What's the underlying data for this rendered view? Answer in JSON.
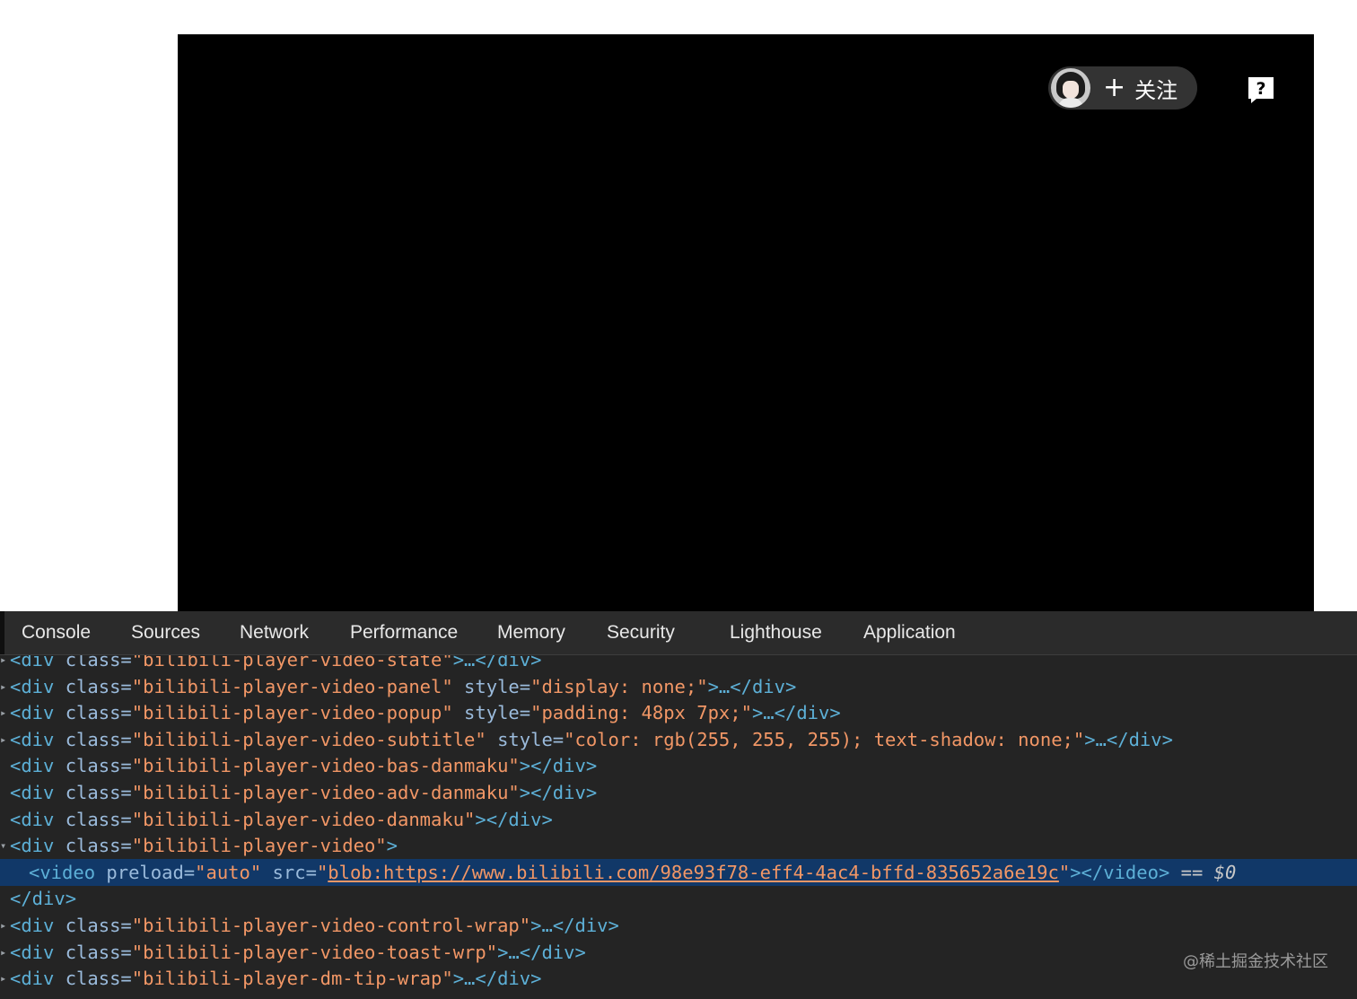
{
  "player": {
    "follow_label": "关注",
    "plus_symbol": "+",
    "help_symbol": "?"
  },
  "devtools": {
    "tabs": [
      "Console",
      "Sources",
      "Network",
      "Performance",
      "Memory",
      "Security",
      "Lighthouse",
      "Application"
    ],
    "lines": [
      {
        "prefix": "<div ",
        "attr": "class=",
        "value": "\"bilibili-player-video-state\"",
        "suffix": ">…</div>",
        "collapsed": true
      },
      {
        "prefix": "<div ",
        "attr": "class=",
        "value": "\"bilibili-player-video-panel\"",
        "attr2": " style=",
        "value2": "\"display: none;\"",
        "suffix": ">…</div>",
        "collapsed": true
      },
      {
        "prefix": "<div ",
        "attr": "class=",
        "value": "\"bilibili-player-video-popup\"",
        "attr2": " style=",
        "value2": "\"padding: 48px 7px;\"",
        "suffix": ">…</div>",
        "collapsed": true
      },
      {
        "prefix": "<div ",
        "attr": "class=",
        "value": "\"bilibili-player-video-subtitle\"",
        "attr2": " style=",
        "value2": "\"color: rgb(255, 255, 255); text-shadow: none;\"",
        "suffix": ">…</div>",
        "collapsed": true
      },
      {
        "prefix": "<div ",
        "attr": "class=",
        "value": "\"bilibili-player-video-bas-danmaku\"",
        "suffix": "></div>"
      },
      {
        "prefix": "<div ",
        "attr": "class=",
        "value": "\"bilibili-player-video-adv-danmaku\"",
        "suffix": "></div>"
      },
      {
        "prefix": "<div ",
        "attr": "class=",
        "value": "\"bilibili-player-video-danmaku\"",
        "suffix": "></div>"
      },
      {
        "prefix": "<div ",
        "attr": "class=",
        "value": "\"bilibili-player-video\"",
        "suffix": ">",
        "expanded": true
      },
      {
        "selected": true,
        "prefix": "<video ",
        "attr": "preload=",
        "value": "\"auto\"",
        "attr2": " src=",
        "link": "blob:https://www.bilibili.com/98e93f78-eff4-4ac4-bffd-835652a6e19c",
        "suffix": "></video>",
        "eq": " == ",
        "dollar": "$0"
      },
      {
        "prefix": "</div>"
      },
      {
        "prefix": "<div ",
        "attr": "class=",
        "value": "\"bilibili-player-video-control-wrap\"",
        "suffix": ">…</div>",
        "collapsed": true
      },
      {
        "prefix": "<div ",
        "attr": "class=",
        "value": "\"bilibili-player-video-toast-wrp\"",
        "suffix": ">…</div>",
        "collapsed": true
      },
      {
        "prefix": "<div ",
        "attr": "class=",
        "value": "\"bilibili-player-dm-tip-wrap\"",
        "suffix": ">…</div>",
        "collapsed": true
      }
    ]
  },
  "watermark": "@稀土掘金技术社区",
  "colors": {
    "tag": "#5db0d7",
    "attr": "#9bbbdc",
    "value": "#f29766",
    "selected_bg": "#113868",
    "devtools_bg": "#242424"
  }
}
